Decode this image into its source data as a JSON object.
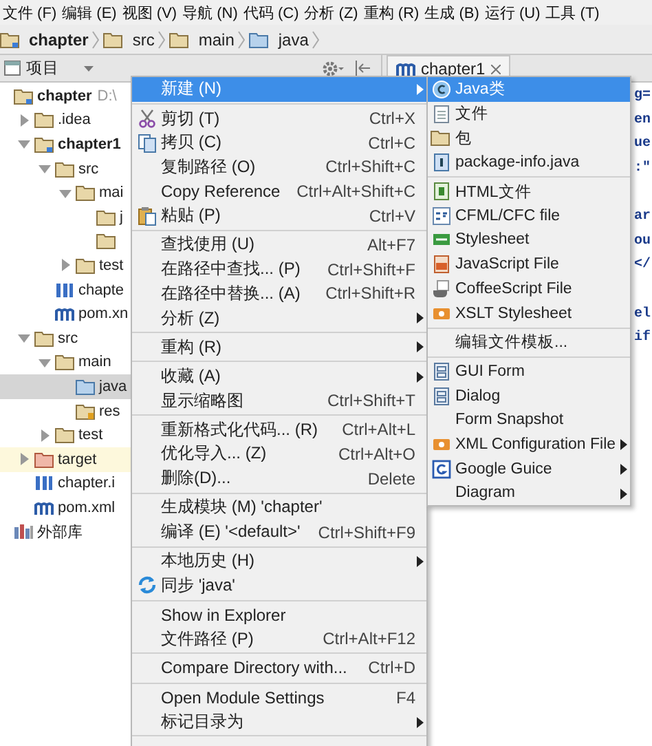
{
  "menubar": [
    "文件 (F)",
    "编辑 (E)",
    "视图 (V)",
    "导航 (N)",
    "代码 (C)",
    "分析 (Z)",
    "重构 (R)",
    "生成 (B)",
    "运行 (U)",
    "工具 (T)"
  ],
  "breadcrumb": [
    {
      "label": "chapter",
      "kind": "module"
    },
    {
      "label": "src",
      "kind": "folder"
    },
    {
      "label": "main",
      "kind": "folder"
    },
    {
      "label": "java",
      "kind": "source"
    }
  ],
  "project_panel": {
    "title": "项目"
  },
  "editor_tab": {
    "label": "chapter1"
  },
  "tree": [
    {
      "label": "chapter",
      "path": "D:\\",
      "kind": "module",
      "selected": false,
      "children": [
        {
          "label": ".idea",
          "kind": "folder",
          "expanded": false,
          "selected": false
        },
        {
          "label": "chapter1",
          "kind": "module",
          "expanded": true,
          "selected": false,
          "children": [
            {
              "label": "src",
              "kind": "folder",
              "expanded": true,
              "selected": false,
              "children": [
                {
                  "label": "mai",
                  "kind": "folder",
                  "expanded": true,
                  "selected": false,
                  "children": [
                    {
                      "label": "j",
                      "kind": "folder",
                      "selected": false
                    },
                    {
                      "kind": "folder",
                      "selected": false
                    }
                  ]
                },
                {
                  "label": "test",
                  "kind": "folder",
                  "expanded": false,
                  "selected": false
                }
              ]
            },
            {
              "label": "chapte",
              "kind": "iml",
              "selected": false
            },
            {
              "label": "pom.xn",
              "kind": "pom",
              "selected": false
            }
          ]
        },
        {
          "label": "src",
          "kind": "folder",
          "expanded": true,
          "selected": false,
          "children": [
            {
              "label": "main",
              "kind": "folder",
              "expanded": true,
              "selected": false,
              "children": [
                {
                  "label": "java",
                  "kind": "source",
                  "selected": true
                },
                {
                  "label": "res",
                  "kind": "resources",
                  "selected": false
                }
              ]
            },
            {
              "label": "test",
              "kind": "folder",
              "expanded": false,
              "selected": false
            }
          ]
        },
        {
          "label": "target",
          "kind": "excluded",
          "expanded": false,
          "selected": false
        },
        {
          "label": "chapter.i",
          "kind": "iml",
          "selected": false
        },
        {
          "label": "pom.xml",
          "kind": "pom",
          "selected": false
        }
      ]
    },
    {
      "label": "外部库",
      "kind": "library",
      "selected": false
    }
  ],
  "code_lines": [
    "g=",
    "en",
    "ue",
    ":\"",
    "ar",
    "ou",
    "</",
    "el",
    "if"
  ],
  "context_menu": [
    {
      "kind": "item",
      "label": "新建 (N)",
      "submenu": true,
      "selected": true
    },
    {
      "kind": "separator"
    },
    {
      "kind": "item",
      "label": "剪切 (T)",
      "shortcut": "Ctrl+X",
      "selected": false
    },
    {
      "kind": "item",
      "label": "拷贝 (C)",
      "shortcut": "Ctrl+C",
      "selected": false
    },
    {
      "kind": "item",
      "label": "复制路径 (O)",
      "shortcut": "Ctrl+Shift+C",
      "selected": false
    },
    {
      "kind": "item",
      "label": "Copy Reference",
      "shortcut": "Ctrl+Alt+Shift+C",
      "selected": false
    },
    {
      "kind": "item",
      "label": "粘贴 (P)",
      "shortcut": "Ctrl+V",
      "selected": false
    },
    {
      "kind": "separator"
    },
    {
      "kind": "item",
      "label": "查找使用 (U)",
      "shortcut": "Alt+F7",
      "selected": false
    },
    {
      "kind": "item",
      "label": "在路径中查找... (P)",
      "shortcut": "Ctrl+Shift+F",
      "selected": false
    },
    {
      "kind": "item",
      "label": "在路径中替换... (A)",
      "shortcut": "Ctrl+Shift+R",
      "selected": false
    },
    {
      "kind": "item",
      "label": "分析 (Z)",
      "submenu": true,
      "selected": false
    },
    {
      "kind": "separator"
    },
    {
      "kind": "item",
      "label": "重构 (R)",
      "submenu": true,
      "selected": false
    },
    {
      "kind": "separator"
    },
    {
      "kind": "item",
      "label": "收藏 (A)",
      "submenu": true,
      "selected": false
    },
    {
      "kind": "item",
      "label": "显示缩略图",
      "shortcut": "Ctrl+Shift+T",
      "selected": false
    },
    {
      "kind": "separator"
    },
    {
      "kind": "item",
      "label": "重新格式化代码... (R)",
      "shortcut": "Ctrl+Alt+L",
      "selected": false
    },
    {
      "kind": "item",
      "label": "优化导入... (Z)",
      "shortcut": "Ctrl+Alt+O",
      "selected": false
    },
    {
      "kind": "item",
      "label": "删除(D)...",
      "shortcut": "Delete",
      "selected": false
    },
    {
      "kind": "separator"
    },
    {
      "kind": "item",
      "label": "生成模块 (M) 'chapter'",
      "selected": false
    },
    {
      "kind": "item",
      "label": "编译 (E) '<default>'",
      "shortcut": "Ctrl+Shift+F9",
      "selected": false
    },
    {
      "kind": "separator"
    },
    {
      "kind": "item",
      "label": "本地历史 (H)",
      "submenu": true,
      "selected": false
    },
    {
      "kind": "item",
      "label": "同步 'java'",
      "selected": false
    },
    {
      "kind": "separator"
    },
    {
      "kind": "item",
      "label": "Show in Explorer",
      "selected": false
    },
    {
      "kind": "item",
      "label": "文件路径 (P)",
      "shortcut": "Ctrl+Alt+F12",
      "selected": false
    },
    {
      "kind": "separator"
    },
    {
      "kind": "item",
      "label": "Compare Directory with...",
      "shortcut": "Ctrl+D",
      "selected": false
    },
    {
      "kind": "separator"
    },
    {
      "kind": "item",
      "label": "Open Module Settings",
      "shortcut": "F4",
      "selected": false
    },
    {
      "kind": "item",
      "label": "标记目录为",
      "submenu": true,
      "selected": false
    },
    {
      "kind": "separator"
    }
  ],
  "new_submenu": [
    {
      "kind": "item",
      "label": "Java类",
      "selected": true
    },
    {
      "kind": "item",
      "label": "文件",
      "selected": false
    },
    {
      "kind": "item",
      "label": "包",
      "selected": false
    },
    {
      "kind": "item",
      "label": "package-info.java",
      "selected": false
    },
    {
      "kind": "separator"
    },
    {
      "kind": "item",
      "label": "HTML文件",
      "selected": false
    },
    {
      "kind": "item",
      "label": "CFML/CFC file",
      "selected": false
    },
    {
      "kind": "item",
      "label": "Stylesheet",
      "selected": false
    },
    {
      "kind": "item",
      "label": "JavaScript File",
      "selected": false
    },
    {
      "kind": "item",
      "label": "CoffeeScript File",
      "selected": false
    },
    {
      "kind": "item",
      "label": "XSLT Stylesheet",
      "selected": false
    },
    {
      "kind": "separator"
    },
    {
      "kind": "item",
      "label": "编辑文件模板...",
      "selected": false
    },
    {
      "kind": "separator"
    },
    {
      "kind": "item",
      "label": "GUI Form",
      "selected": false
    },
    {
      "kind": "item",
      "label": "Dialog",
      "selected": false
    },
    {
      "kind": "item",
      "label": "Form Snapshot",
      "selected": false
    },
    {
      "kind": "item",
      "label": "XML Configuration File",
      "submenu": true,
      "selected": false
    },
    {
      "kind": "item",
      "label": "Google Guice",
      "submenu": true,
      "selected": false
    },
    {
      "kind": "item",
      "label": "Diagram",
      "submenu": true,
      "selected": false
    }
  ]
}
